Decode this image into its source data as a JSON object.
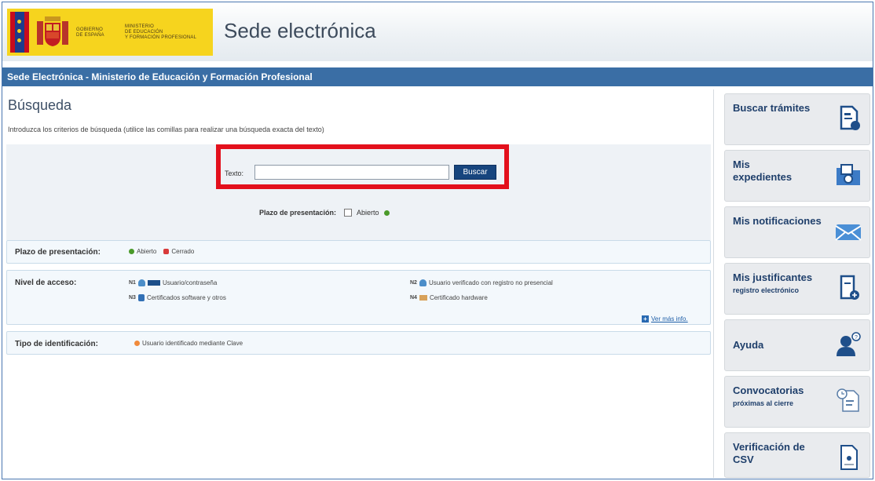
{
  "header": {
    "gov_text_line1": "GOBIERNO",
    "gov_text_line2": "DE ESPAÑA",
    "ministry_line1": "MINISTERIO",
    "ministry_line2": "DE EDUCACIÓN",
    "ministry_line3": "Y FORMACIÓN PROFESIONAL",
    "title": "Sede electrónica"
  },
  "bluebar": {
    "text": "Sede Electrónica - Ministerio de Educación y Formación Profesional"
  },
  "main": {
    "title": "Búsqueda",
    "intro": "Introduzca los criterios de búsqueda (utilice las comillas para realizar una búsqueda exacta del texto)",
    "search": {
      "label": "Texto:",
      "value": "",
      "button": "Buscar"
    },
    "plazo_filter": {
      "label": "Plazo de presentación:",
      "option": "Abierto"
    }
  },
  "legend": {
    "plazo": {
      "title": "Plazo de presentación:",
      "abierto": "Abierto",
      "cerrado": "Cerrado"
    },
    "nivel": {
      "title": "Nivel de acceso:",
      "n1_code": "N1",
      "n1_text": "Usuario/contraseña",
      "n2_code": "N2",
      "n2_text": "Usuario verificado con registro no presencial",
      "n3_code": "N3",
      "n3_text": "Certificados software y otros",
      "n4_code": "N4",
      "n4_text": "Certificado hardware",
      "ver_mas": "Ver más info."
    },
    "tipo": {
      "title": "Tipo de identificación:",
      "text": "Usuario identificado mediante Clave"
    }
  },
  "side": {
    "items": [
      {
        "label": "Buscar trámites",
        "sub": "",
        "icon": "search-document-icon"
      },
      {
        "label": "Mis expedientes",
        "sub": "",
        "icon": "folder-search-icon"
      },
      {
        "label": "Mis notificaciones",
        "sub": "",
        "icon": "envelope-icon"
      },
      {
        "label": "Mis justificantes",
        "sub": "registro electrónico",
        "icon": "receipt-icon"
      },
      {
        "label": "Ayuda",
        "sub": "",
        "icon": "help-user-icon"
      },
      {
        "label": "Convocatorias",
        "sub": "próximas al cierre",
        "icon": "calendar-document-icon"
      },
      {
        "label": "Verificación de CSV",
        "sub": "",
        "icon": "csv-document-icon"
      }
    ]
  }
}
